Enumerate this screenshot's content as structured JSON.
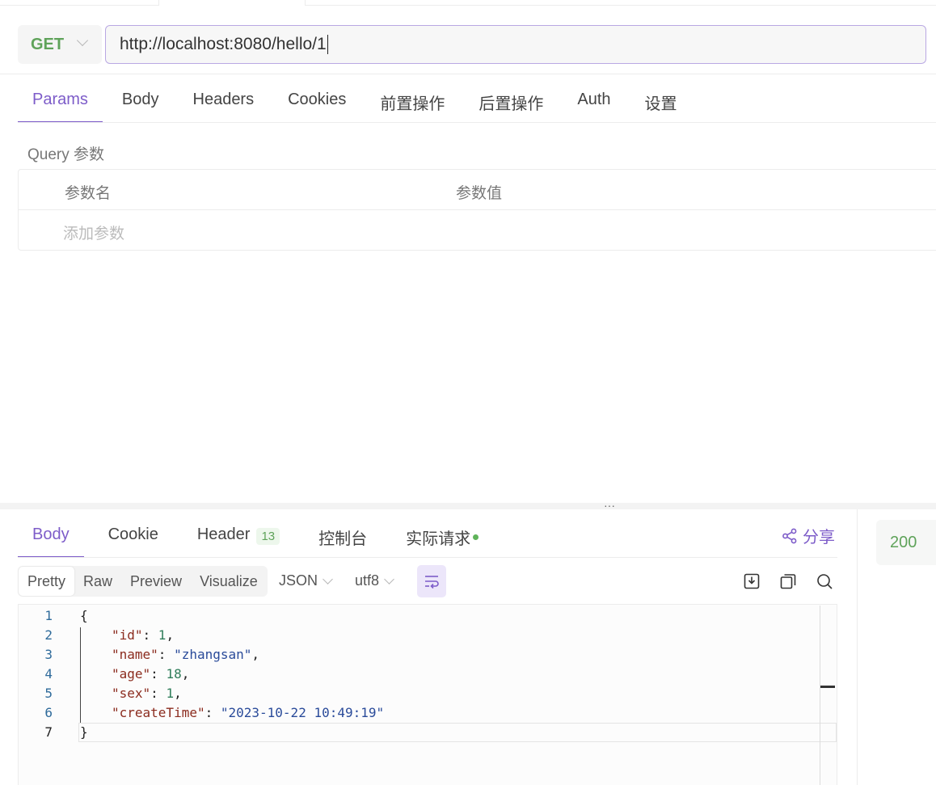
{
  "request": {
    "method": "GET",
    "url": "http://localhost:8080/hello/1"
  },
  "request_tabs": [
    {
      "label": "Params",
      "active": true
    },
    {
      "label": "Body",
      "active": false
    },
    {
      "label": "Headers",
      "active": false
    },
    {
      "label": "Cookies",
      "active": false
    },
    {
      "label": "前置操作",
      "active": false
    },
    {
      "label": "后置操作",
      "active": false
    },
    {
      "label": "Auth",
      "active": false
    },
    {
      "label": "设置",
      "active": false
    }
  ],
  "params": {
    "section_label": "Query 参数",
    "col_name": "参数名",
    "col_value": "参数值",
    "add_placeholder": "添加参数"
  },
  "splitter_glyph": "···",
  "response_tabs": {
    "body": "Body",
    "cookie": "Cookie",
    "header": "Header",
    "header_count": "13",
    "console": "控制台",
    "actual_request": "实际请求"
  },
  "share_label": "分享",
  "status_code": "200",
  "view_modes": [
    "Pretty",
    "Raw",
    "Preview",
    "Visualize"
  ],
  "active_view": "Pretty",
  "format": "JSON",
  "encoding": "utf8",
  "colors": {
    "accent": "#7d5cc9",
    "success": "#5fa35a"
  },
  "icons": {
    "wrap": "word-wrap-icon",
    "download": "download-icon",
    "copy": "copy-icon",
    "search": "search-icon",
    "share": "share-icon"
  },
  "code": {
    "line_numbers": [
      "1",
      "2",
      "3",
      "4",
      "5",
      "6",
      "7"
    ],
    "open_brace": "{",
    "close_brace": "}",
    "fields": [
      {
        "key": "\"id\"",
        "value": "1",
        "vtype": "n",
        "comma": true
      },
      {
        "key": "\"name\"",
        "value": "\"zhangsan\"",
        "vtype": "s",
        "comma": true
      },
      {
        "key": "\"age\"",
        "value": "18",
        "vtype": "n",
        "comma": true
      },
      {
        "key": "\"sex\"",
        "value": "1",
        "vtype": "n",
        "comma": true
      },
      {
        "key": "\"createTime\"",
        "value": "\"2023-10-22 10:49:19\"",
        "vtype": "s",
        "comma": false
      }
    ]
  }
}
